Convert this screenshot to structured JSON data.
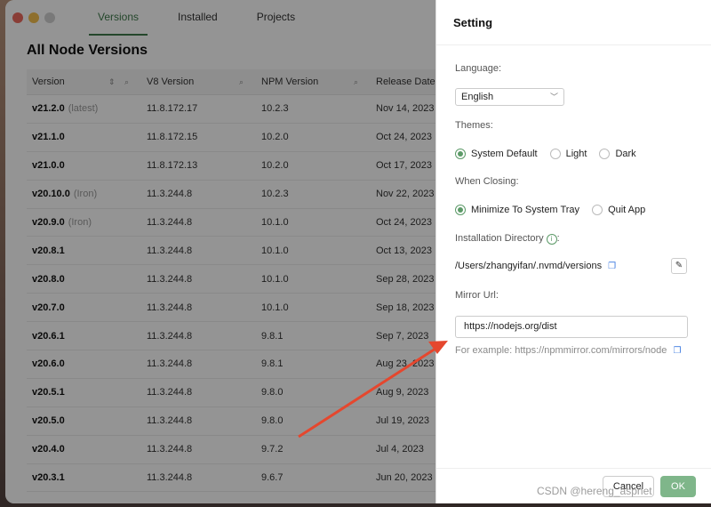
{
  "tabs": [
    "Versions",
    "Installed",
    "Projects"
  ],
  "page_title": "All Node Versions",
  "table": {
    "headers": [
      "Version",
      "V8 Version",
      "NPM Version",
      "Release Date"
    ],
    "rows": [
      {
        "version": "v21.2.0",
        "tag": "(latest)",
        "v8": "11.8.172.17",
        "npm": "10.2.3",
        "date": "Nov 14, 2023"
      },
      {
        "version": "v21.1.0",
        "tag": "",
        "v8": "11.8.172.15",
        "npm": "10.2.0",
        "date": "Oct 24, 2023"
      },
      {
        "version": "v21.0.0",
        "tag": "",
        "v8": "11.8.172.13",
        "npm": "10.2.0",
        "date": "Oct 17, 2023"
      },
      {
        "version": "v20.10.0",
        "tag": "(Iron)",
        "v8": "11.3.244.8",
        "npm": "10.2.3",
        "date": "Nov 22, 2023"
      },
      {
        "version": "v20.9.0",
        "tag": "(Iron)",
        "v8": "11.3.244.8",
        "npm": "10.1.0",
        "date": "Oct 24, 2023"
      },
      {
        "version": "v20.8.1",
        "tag": "",
        "v8": "11.3.244.8",
        "npm": "10.1.0",
        "date": "Oct 13, 2023"
      },
      {
        "version": "v20.8.0",
        "tag": "",
        "v8": "11.3.244.8",
        "npm": "10.1.0",
        "date": "Sep 28, 2023"
      },
      {
        "version": "v20.7.0",
        "tag": "",
        "v8": "11.3.244.8",
        "npm": "10.1.0",
        "date": "Sep 18, 2023"
      },
      {
        "version": "v20.6.1",
        "tag": "",
        "v8": "11.3.244.8",
        "npm": "9.8.1",
        "date": "Sep 7, 2023"
      },
      {
        "version": "v20.6.0",
        "tag": "",
        "v8": "11.3.244.8",
        "npm": "9.8.1",
        "date": "Aug 23, 2023"
      },
      {
        "version": "v20.5.1",
        "tag": "",
        "v8": "11.3.244.8",
        "npm": "9.8.0",
        "date": "Aug 9, 2023"
      },
      {
        "version": "v20.5.0",
        "tag": "",
        "v8": "11.3.244.8",
        "npm": "9.8.0",
        "date": "Jul 19, 2023"
      },
      {
        "version": "v20.4.0",
        "tag": "",
        "v8": "11.3.244.8",
        "npm": "9.7.2",
        "date": "Jul 4, 2023"
      },
      {
        "version": "v20.3.1",
        "tag": "",
        "v8": "11.3.244.8",
        "npm": "9.6.7",
        "date": "Jun 20, 2023"
      }
    ]
  },
  "settings": {
    "title": "Setting",
    "language_label": "Language",
    "language_value": "English",
    "themes_label": "Themes",
    "themes": [
      "System Default",
      "Light",
      "Dark"
    ],
    "themes_selected": "System Default",
    "closing_label": "When Closing",
    "closing_options": [
      "Minimize To System Tray",
      "Quit App"
    ],
    "closing_selected": "Minimize To System Tray",
    "install_dir_label": "Installation Directory",
    "install_dir_value": "/Users/zhangyifan/.nvmd/versions",
    "mirror_label": "Mirror Url",
    "mirror_value": "https://nodejs.org/dist",
    "mirror_hint": "For example: https://npmmirror.com/mirrors/node",
    "cancel_label": "Cancel",
    "ok_label": "OK"
  },
  "colors": {
    "accent": "#5c9a68",
    "arrow": "#e5472e"
  },
  "watermark": "CSDN @hereng_aspnet"
}
